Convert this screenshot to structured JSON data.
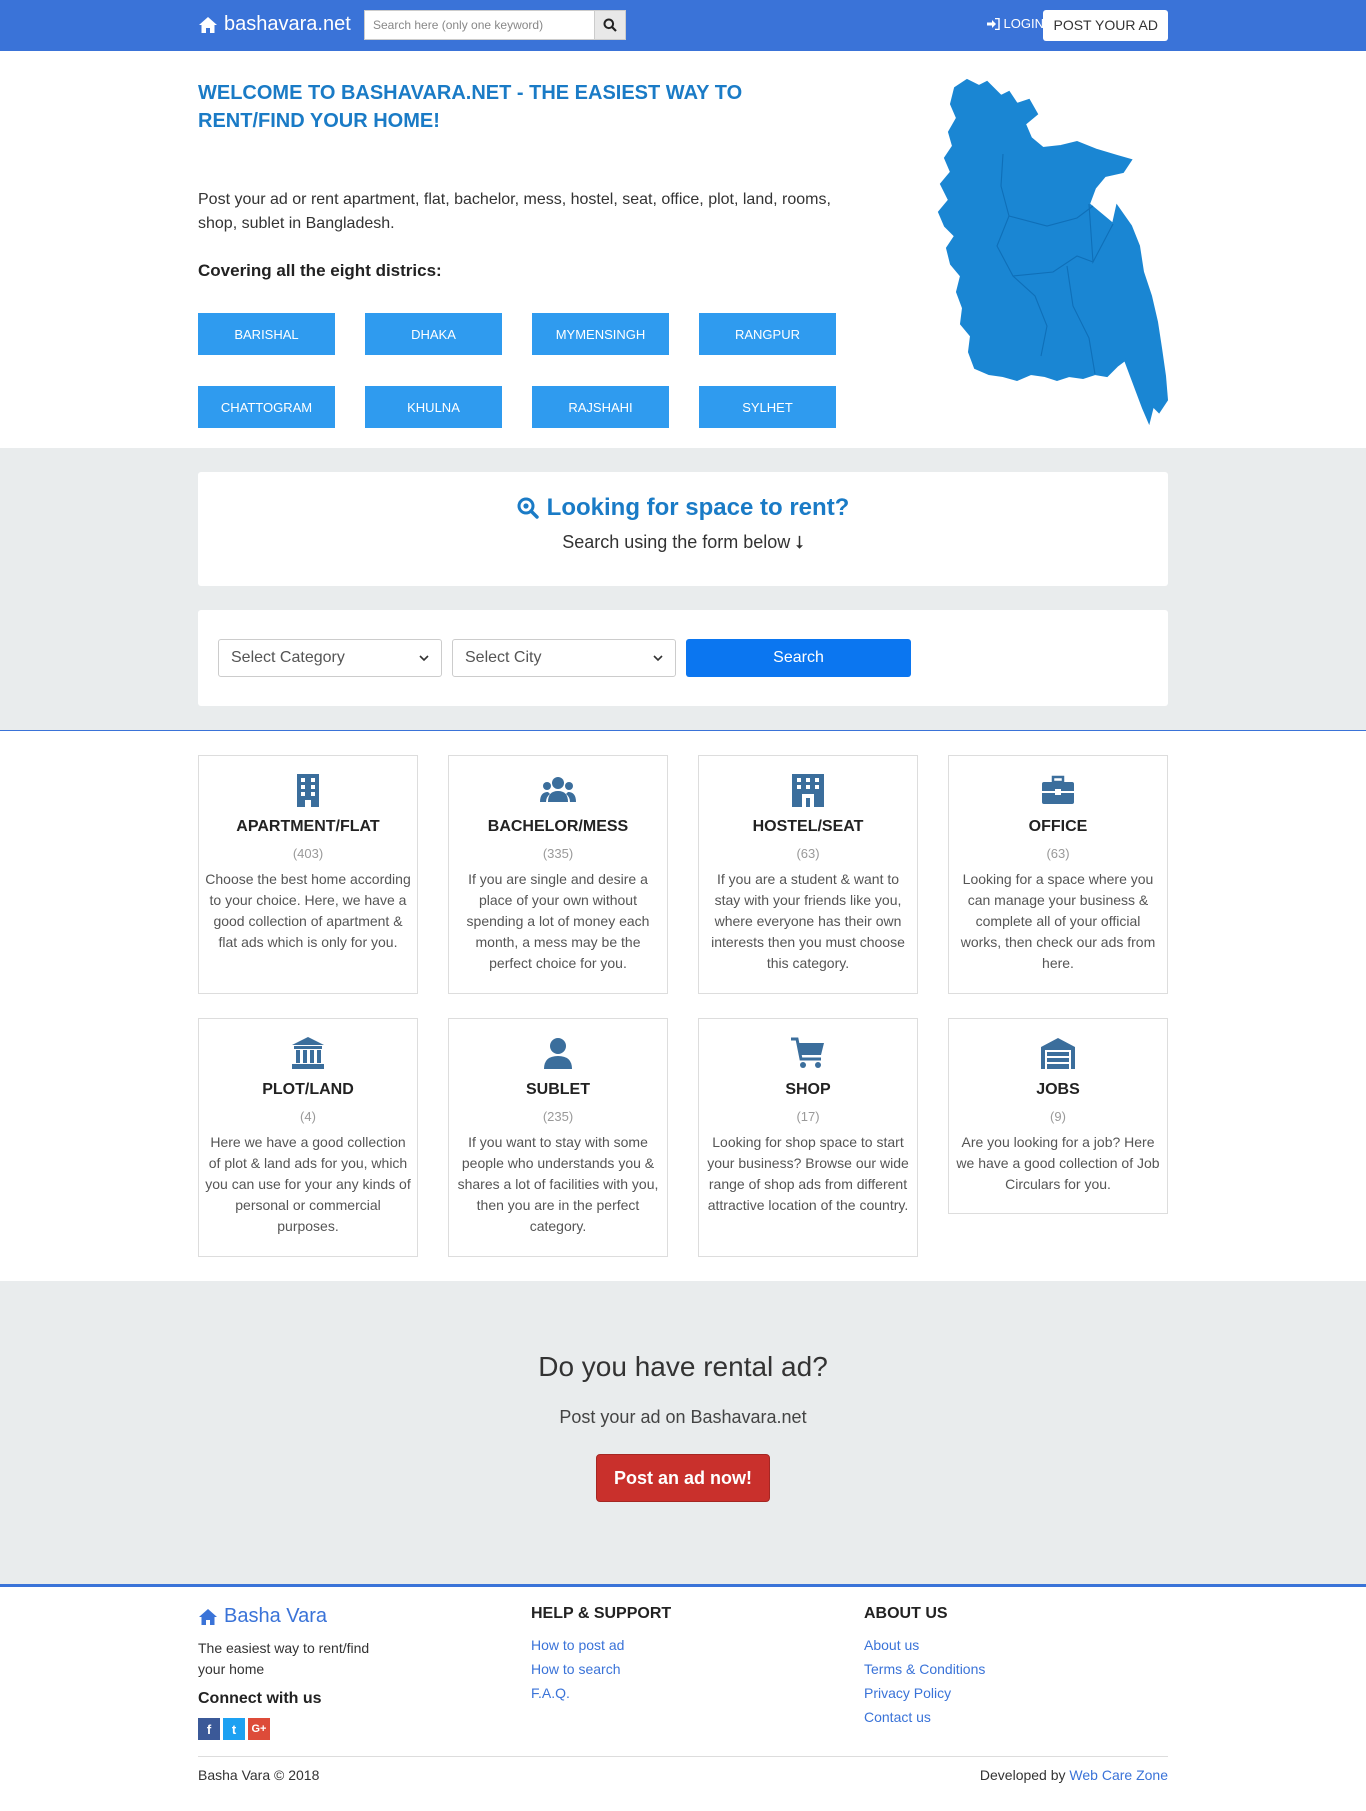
{
  "header": {
    "brand": "bashavara.net",
    "search_placeholder": "Search here (only one keyword)",
    "login": "LOGIN",
    "post_ad": "POST YOUR AD"
  },
  "hero": {
    "title": "WELCOME TO BASHAVARA.NET - THE EASIEST WAY TO RENT/FIND YOUR HOME!",
    "lead": "Post your ad or rent apartment, flat, bachelor, mess, hostel, seat, office, plot, land, rooms, shop, sublet in Bangladesh.",
    "cover_heading": "Covering all the eight districs:",
    "districts": [
      "BARISHAL",
      "DHAKA",
      "MYMENSINGH",
      "RANGPUR",
      "CHATTOGRAM",
      "KHULNA",
      "RAJSHAHI",
      "SYLHET"
    ]
  },
  "looking": {
    "title": "Looking for space to rent?",
    "subtitle": "Search using the form below"
  },
  "search_form": {
    "category": "Select Category",
    "city": "Select City",
    "button": "Search"
  },
  "categories": [
    {
      "title": "APARTMENT/FLAT",
      "count": "(403)",
      "desc": "Choose the best home according to your choice. Here, we have a good collection of apartment & flat ads which is only for you.",
      "icon": "building-icon"
    },
    {
      "title": "BACHELOR/MESS",
      "count": "(335)",
      "desc": "If you are single and desire a place of your own without spending a lot of money each month, a mess may be the perfect choice for you.",
      "icon": "users-icon"
    },
    {
      "title": "HOSTEL/SEAT",
      "count": "(63)",
      "desc": "If you are a student & want to stay with your friends like you, where everyone has their own interests then you must choose this category.",
      "icon": "hostel-icon"
    },
    {
      "title": "OFFICE",
      "count": "(63)",
      "desc": "Looking for a space where you can manage your business & complete all of your official works, then check our ads from here.",
      "icon": "briefcase-icon"
    },
    {
      "title": "PLOT/LAND",
      "count": "(4)",
      "desc": "Here we have a good collection of plot & land ads for you, which you can use for your any kinds of personal or commercial purposes.",
      "icon": "bank-icon"
    },
    {
      "title": "SUBLET",
      "count": "(235)",
      "desc": "If you want to stay with some people who understands you & shares a lot of facilities with you, then you are in the perfect category.",
      "icon": "user-icon"
    },
    {
      "title": "SHOP",
      "count": "(17)",
      "desc": "Looking for shop space to start your business? Browse our wide range of shop ads from different attractive location of the country.",
      "icon": "cart-icon"
    },
    {
      "title": "JOBS",
      "count": "(9)",
      "desc": "Are you looking for a job? Here we have a good collection of Job Circulars for you.",
      "icon": "warehouse-icon"
    }
  ],
  "cta": {
    "title": "Do you have rental ad?",
    "subtitle": "Post your ad on Bashavara.net",
    "button": "Post an ad now!"
  },
  "footer": {
    "brand": "Basha Vara",
    "tagline": "The easiest way to rent/find your home",
    "connect": "Connect with us",
    "help_title": "HELP & SUPPORT",
    "help_links": [
      "How to post ad",
      "How to search",
      "F.A.Q."
    ],
    "about_title": "ABOUT US",
    "about_links": [
      "About us",
      "Terms & Conditions",
      "Privacy Policy",
      "Contact us"
    ],
    "copyright": "Basha Vara © 2018",
    "developed_by": "Developed by",
    "developer": "Web Care Zone"
  },
  "colors": {
    "header_bg": "#3a73d8",
    "accent": "#1a7bc6",
    "district_btn": "#2f9bef",
    "search_btn": "#0b76f0",
    "cta_btn": "#c9302c",
    "icon": "#3b6e9c"
  }
}
